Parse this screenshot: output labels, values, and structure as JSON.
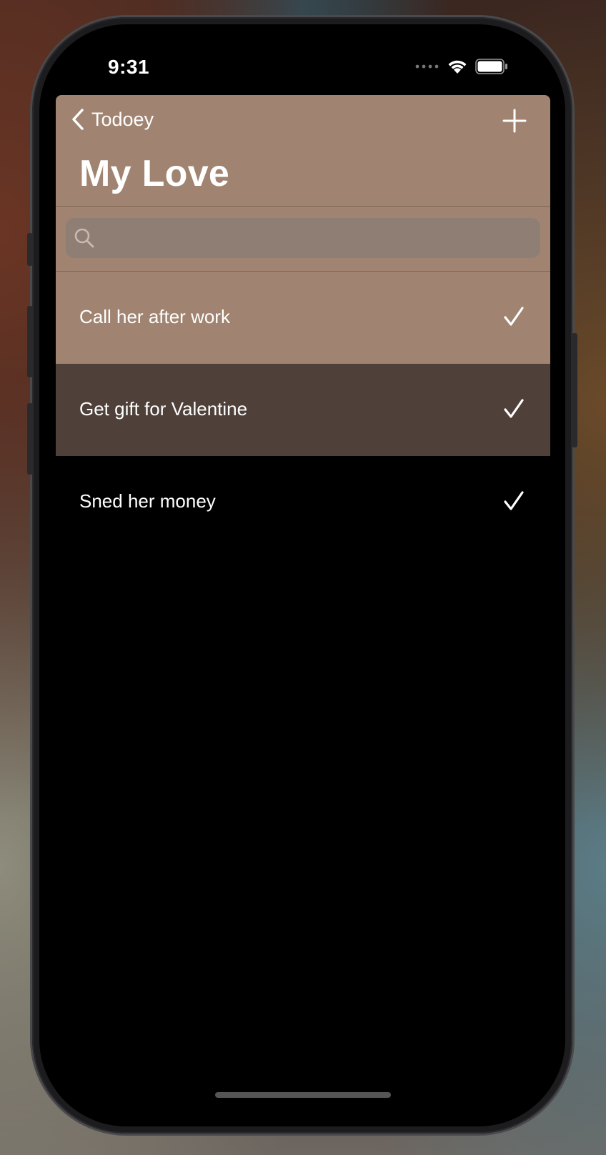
{
  "status_bar": {
    "time": "9:31"
  },
  "nav": {
    "back_label": "Todoey",
    "title": "My Love"
  },
  "search": {
    "placeholder": ""
  },
  "items": [
    {
      "label": "Call her after work",
      "done": true,
      "bg": "#a08471"
    },
    {
      "label": "Get gift for Valentine",
      "done": true,
      "bg": "#4f4039"
    },
    {
      "label": "Sned her money",
      "done": true,
      "bg": "#000000"
    }
  ],
  "colors": {
    "nav_bg": "#a08471",
    "search_bg": "#8f7e74"
  },
  "icons": [
    "chevron-left-icon",
    "plus-icon",
    "search-icon",
    "checkmark-icon",
    "wifi-icon",
    "battery-icon",
    "signal-icon"
  ]
}
